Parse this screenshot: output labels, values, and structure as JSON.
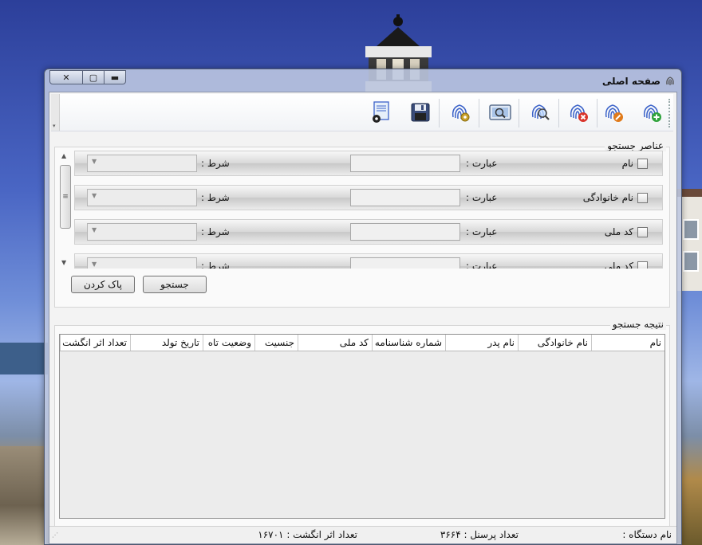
{
  "window": {
    "title": "صفحه اصلی",
    "controls": {
      "close": "✕",
      "maximize": "▢",
      "minimize": "▬"
    }
  },
  "toolbar": {
    "buttons": [
      {
        "name": "fingerprint-add-icon"
      },
      {
        "name": "fingerprint-edit-icon"
      },
      {
        "name": "fingerprint-delete-icon"
      },
      {
        "name": "fingerprint-search-icon"
      },
      {
        "name": "scan-preview-icon"
      },
      {
        "name": "fingerprint-settings-icon"
      },
      {
        "name": "save-icon"
      },
      {
        "name": "document-settings-icon"
      }
    ]
  },
  "search": {
    "group_title": "عناصر جستجو",
    "expression_label": "عبارت :",
    "condition_label": "شرط :",
    "rows": [
      {
        "name": "نام"
      },
      {
        "name": "نام خانوادگی"
      },
      {
        "name": "کد ملی"
      },
      {
        "name": "کد ملی"
      }
    ],
    "search_button": "جستجو",
    "clear_button": "پاک کردن"
  },
  "results": {
    "group_title": "نتیجه جستجو",
    "columns": [
      "نام",
      "نام خانوادگی",
      "نام پدر",
      "شماره شناسنامه",
      "کد ملی",
      "جنسیت",
      "وضعیت تاه",
      "تاریخ تولد",
      "تعداد اثر انگشت"
    ]
  },
  "status": {
    "device_name": "نام دستگاه :",
    "personnel_count": "تعداد پرسنل : ۳۶۶۴",
    "fingerprint_count": "تعداد اثر انگشت : ۱۶۷۰۱"
  },
  "colors": {
    "fingerprint_blue": "#3c63c9",
    "add_green": "#2fa33c",
    "delete_red": "#d9342b",
    "edit_orange": "#e07a1a"
  }
}
